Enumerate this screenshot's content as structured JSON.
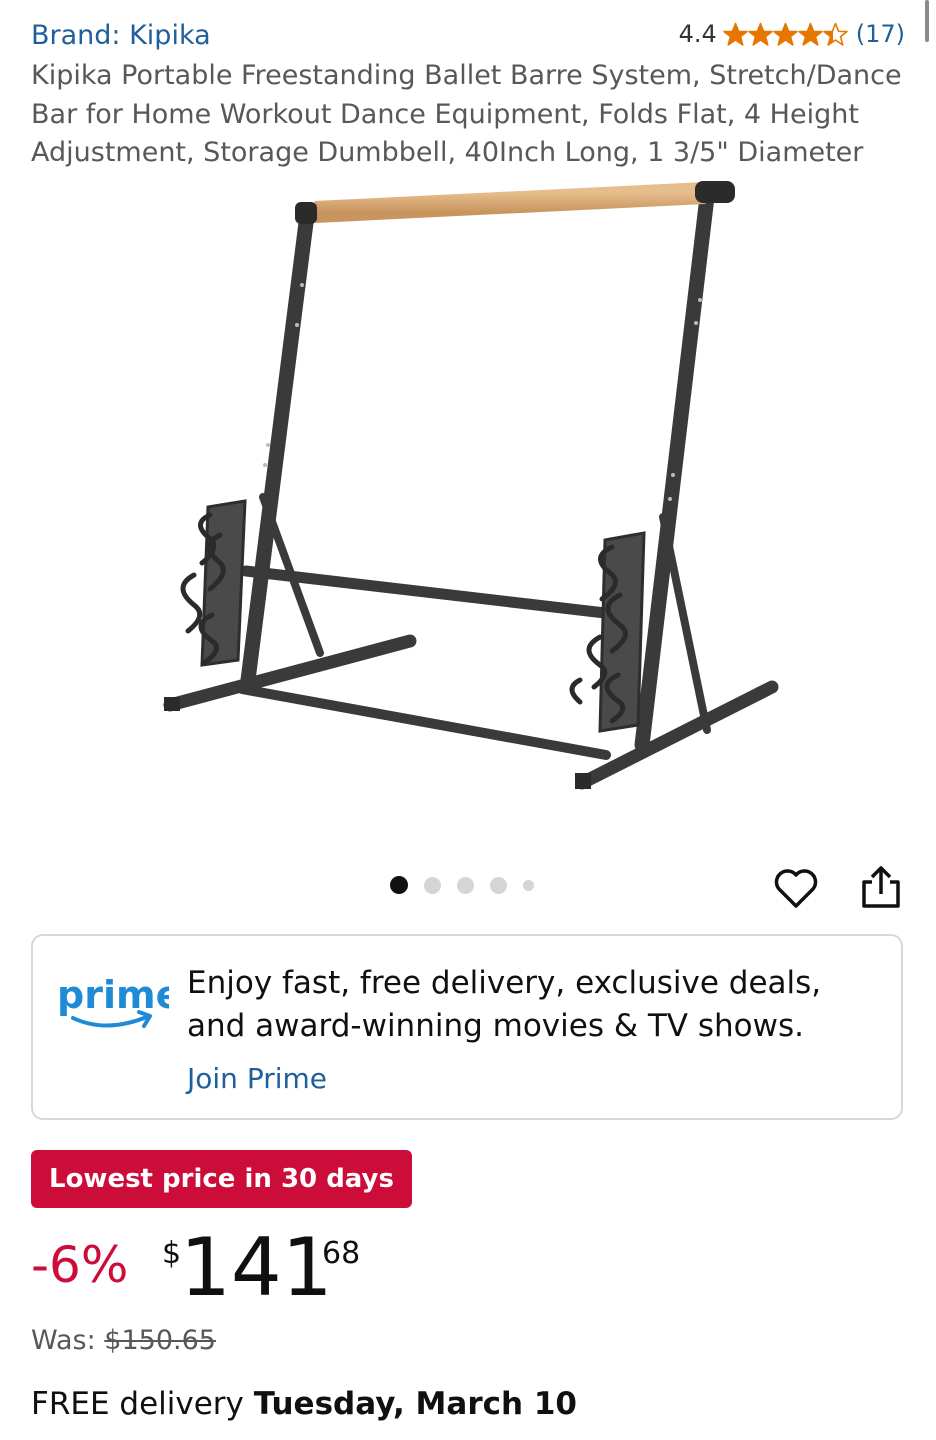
{
  "brand": {
    "label": "Brand: Kipika"
  },
  "rating": {
    "value": "4.4",
    "stars": 4.4,
    "count": "(17)",
    "star_color": "#e77600"
  },
  "product": {
    "title": "Kipika Portable Freestanding Ballet Barre System, Stretch/Dance Bar for Home Workout Dance Equipment, Folds Flat, 4 Height Adjustment, Storage Dumbbell, 40Inch Long, 1 3/5\" Diameter"
  },
  "gallery": {
    "image_count": 5,
    "active_index": 0
  },
  "actions": {
    "wishlist_icon": "heart-icon",
    "share_icon": "share-icon"
  },
  "prime": {
    "logo_text": "prime",
    "message": "Enjoy fast, free delivery, exclusive deals, and award-winning movies & TV shows.",
    "cta": "Join Prime"
  },
  "deal": {
    "badge": "Lowest price in 30 days",
    "badge_color": "#cc0c39"
  },
  "price": {
    "discount": "-6%",
    "symbol": "$",
    "whole": "141",
    "fraction": "68",
    "was_label": "Was:",
    "was_value": "$150.65"
  },
  "delivery": {
    "prefix": "FREE delivery",
    "date": "Tuesday, March 10"
  },
  "colors": {
    "link": "#1f5f9a",
    "text": "#0f1111",
    "muted": "#565959",
    "sale": "#cc0c39"
  }
}
